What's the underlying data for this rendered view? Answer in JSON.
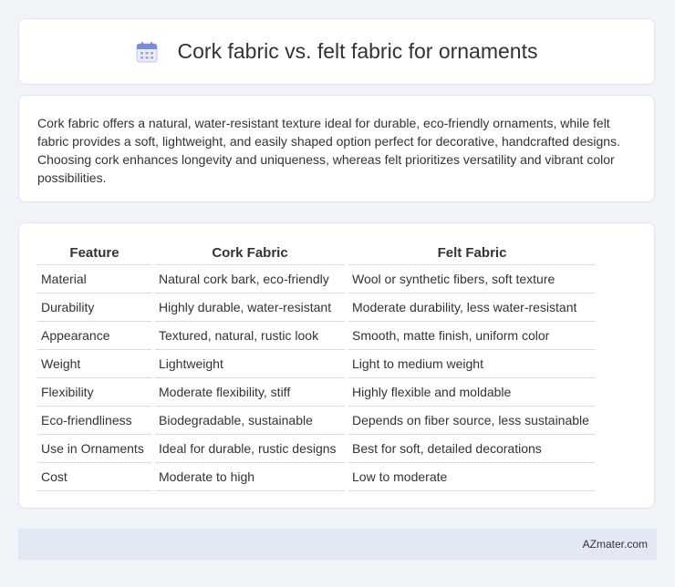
{
  "header": {
    "icon": "calendar-icon",
    "title": "Cork fabric vs. felt fabric for ornaments"
  },
  "summary": {
    "text": "Cork fabric offers a natural, water-resistant texture ideal for durable, eco-friendly ornaments, while felt fabric provides a soft, lightweight, and easily shaped option perfect for decorative, handcrafted designs. Choosing cork enhances longevity and uniqueness, whereas felt prioritizes versatility and vibrant color possibilities."
  },
  "table": {
    "headers": [
      "Feature",
      "Cork Fabric",
      "Felt Fabric"
    ],
    "rows": [
      [
        "Material",
        "Natural cork bark, eco-friendly",
        "Wool or synthetic fibers, soft texture"
      ],
      [
        "Durability",
        "Highly durable, water-resistant",
        "Moderate durability, less water-resistant"
      ],
      [
        "Appearance",
        "Textured, natural, rustic look",
        "Smooth, matte finish, uniform color"
      ],
      [
        "Weight",
        "Lightweight",
        "Light to medium weight"
      ],
      [
        "Flexibility",
        "Moderate flexibility, stiff",
        "Highly flexible and moldable"
      ],
      [
        "Eco-friendliness",
        "Biodegradable, sustainable",
        "Depends on fiber source, less sustainable"
      ],
      [
        "Use in Ornaments",
        "Ideal for durable, rustic designs",
        "Best for soft, detailed decorations"
      ],
      [
        "Cost",
        "Moderate to high",
        "Low to moderate"
      ]
    ]
  },
  "footer": {
    "text": "AZmater.com"
  },
  "colors": {
    "background": "#f0f3f8",
    "footer_bg": "#e3e9f4",
    "icon_accent": "#5b7fe0"
  }
}
